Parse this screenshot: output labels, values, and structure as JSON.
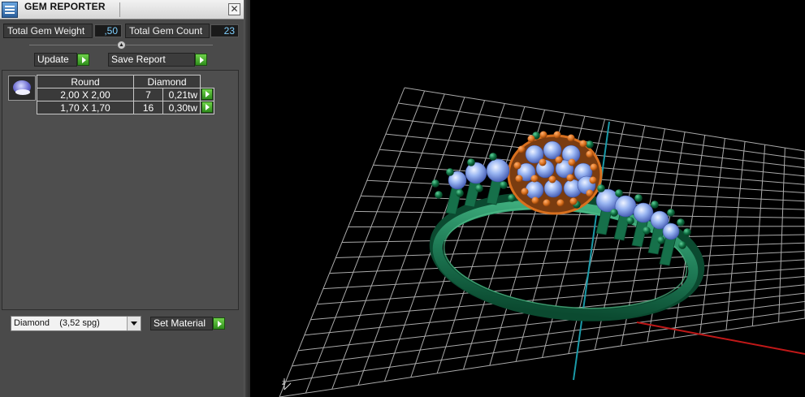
{
  "window": {
    "title": "GEM REPORTER",
    "close_label": "✕"
  },
  "stats": {
    "total_weight_label": "Total Gem Weight",
    "total_weight_value": ",50",
    "total_count_label": "Total Gem Count",
    "total_count_value": "23"
  },
  "actions": {
    "update_label": "Update",
    "save_report_label": "Save Report"
  },
  "table": {
    "headers": [
      "Round",
      "Diamond"
    ],
    "rows": [
      {
        "size": "2,00 X 2,00",
        "count": "7",
        "weight": "0,21tw"
      },
      {
        "size": "1,70 X 1,70",
        "count": "16",
        "weight": "0,30tw"
      }
    ]
  },
  "material": {
    "selected": "Diamond    (3,52 spg)",
    "set_label": "Set Material"
  },
  "viewport": {
    "axis_label": "z"
  },
  "colors": {
    "grid": "#c8c8c8",
    "band": "#1e7a55",
    "orange_prong": "#d9701e",
    "green_prong": "#0c6a3e",
    "stone": "#8fb0f0",
    "axis_x": "#c01818",
    "axis_y": "#1a9aa8",
    "accent_button": "#3fae2a",
    "value_text": "#7fd0ff"
  },
  "icons": [
    "app-icon",
    "close-icon",
    "slider-thumb-icon",
    "play-arrow-icon",
    "gem-thumbnail",
    "dropdown-arrow-icon",
    "axis-gizmo-icon"
  ]
}
